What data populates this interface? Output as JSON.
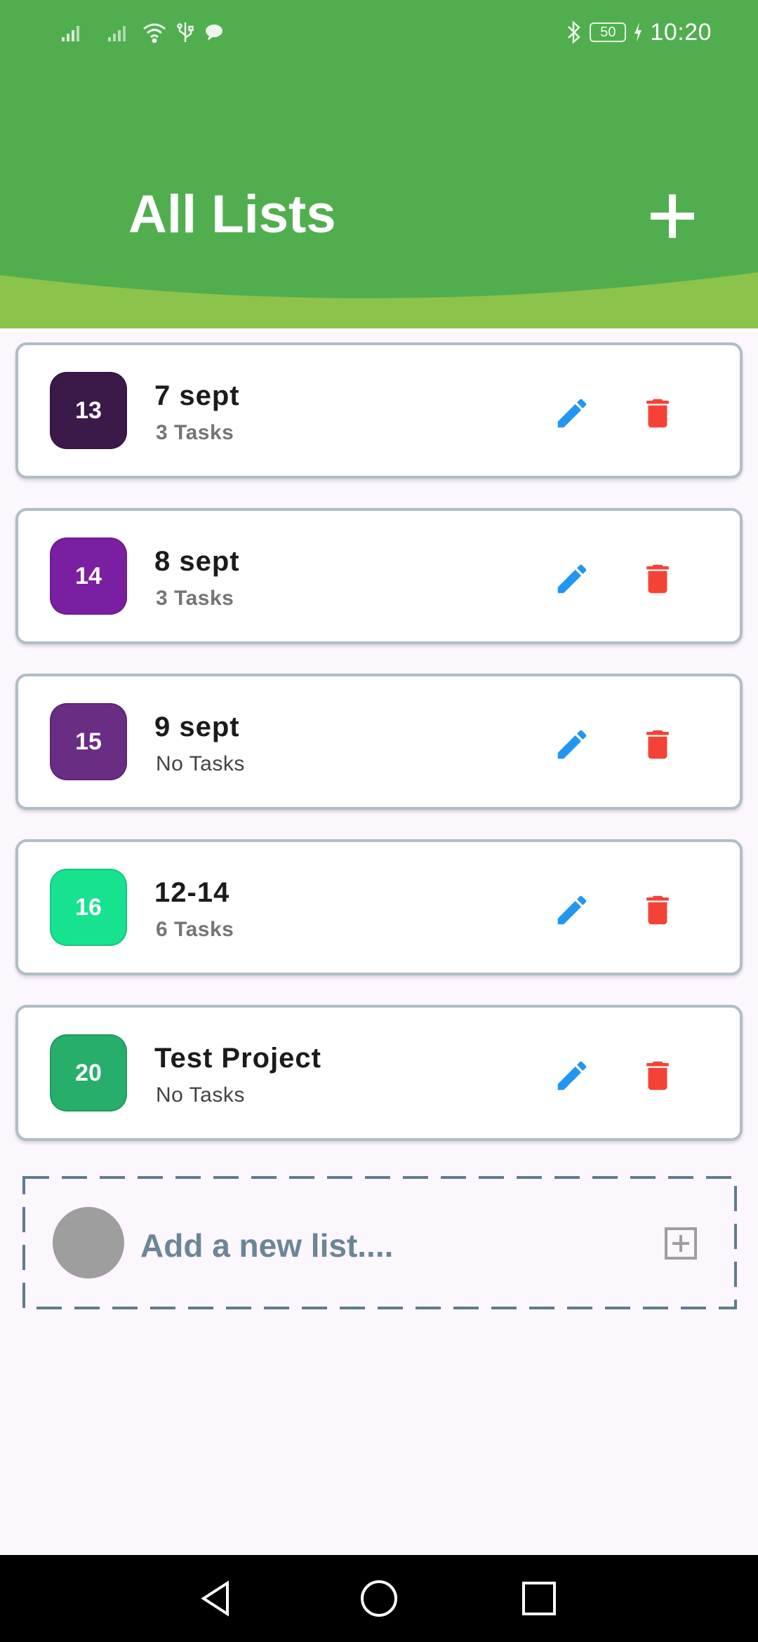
{
  "status_bar": {
    "battery": "50",
    "time": "10:20",
    "icons": [
      "signal-icon",
      "signal-icon",
      "wifi-icon",
      "usb-icon",
      "chat-bubble-icon",
      "bluetooth-icon",
      "battery-icon",
      "charging-icon"
    ]
  },
  "header": {
    "title": "All Lists",
    "add_icon": "plus-icon"
  },
  "lists": [
    {
      "badge": "13",
      "badge_color": "#3b1a4a",
      "title": "7 sept",
      "subtitle": "3 Tasks"
    },
    {
      "badge": "14",
      "badge_color": "#7b1fa2",
      "title": "8 sept",
      "subtitle": "3 Tasks"
    },
    {
      "badge": "15",
      "badge_color": "#6a2d84",
      "title": "9 sept",
      "subtitle": "No Tasks"
    },
    {
      "badge": "16",
      "badge_color": "#17e290",
      "title": "12-14",
      "subtitle": "6 Tasks"
    },
    {
      "badge": "20",
      "badge_color": "#27ae6a",
      "title": "Test Project",
      "subtitle": "No Tasks"
    }
  ],
  "add_new": {
    "label": "Add a new list...."
  },
  "colors": {
    "header_green": "#4caf50",
    "header_lime": "#8bc34a",
    "edit_blue": "#2196f3",
    "delete_red": "#f44336",
    "background": "#fcf6fd"
  },
  "nav": [
    "back-icon",
    "home-icon",
    "recents-icon"
  ]
}
